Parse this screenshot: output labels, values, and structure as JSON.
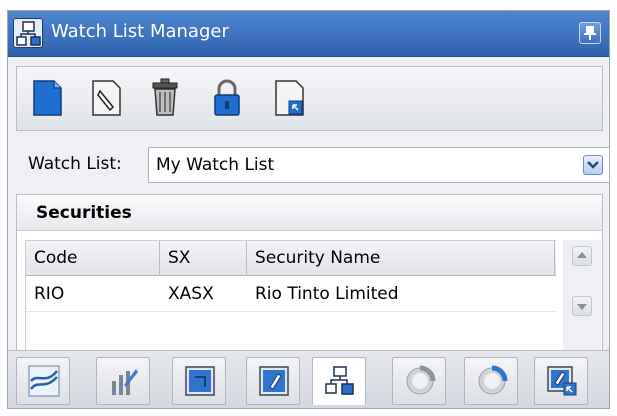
{
  "window": {
    "title": "Watch List Manager",
    "title_icon": "network-icon",
    "pin_icon": "pin-icon"
  },
  "toolbar": {
    "buttons": [
      {
        "name": "new-watchlist-button",
        "icon": "new-document-icon"
      },
      {
        "name": "edit-watchlist-button",
        "icon": "edit-document-icon"
      },
      {
        "name": "delete-watchlist-button",
        "icon": "trash-icon"
      },
      {
        "name": "lock-watchlist-button",
        "icon": "lock-icon"
      },
      {
        "name": "export-watchlist-button",
        "icon": "export-document-icon"
      }
    ]
  },
  "watch_list": {
    "label": "Watch List:",
    "selected": "My Watch List"
  },
  "securities": {
    "title": "Securities",
    "columns": [
      "Code",
      "SX",
      "Security Name"
    ],
    "rows": [
      {
        "code": "RIO",
        "sx": "XASX",
        "name": "Rio Tinto Limited"
      }
    ]
  },
  "tabs": [
    {
      "name": "tab-chart",
      "icon": "line-chart-icon",
      "active": false
    },
    {
      "name": "tab-market-depth",
      "icon": "bar-chart-icon",
      "active": false
    },
    {
      "name": "tab-window-1",
      "icon": "window-icon",
      "active": false
    },
    {
      "name": "tab-window-2",
      "icon": "window-edit-icon",
      "active": false
    },
    {
      "name": "tab-watchlist",
      "icon": "network-icon",
      "active": true
    },
    {
      "name": "tab-gauge-1",
      "icon": "gauge-icon",
      "active": false
    },
    {
      "name": "tab-gauge-2",
      "icon": "gauge-color-icon",
      "active": false
    },
    {
      "name": "tab-window-3",
      "icon": "window-link-icon",
      "active": false
    }
  ],
  "colors": {
    "titlebar": "#2f62ad",
    "accent": "#3b78d0"
  }
}
